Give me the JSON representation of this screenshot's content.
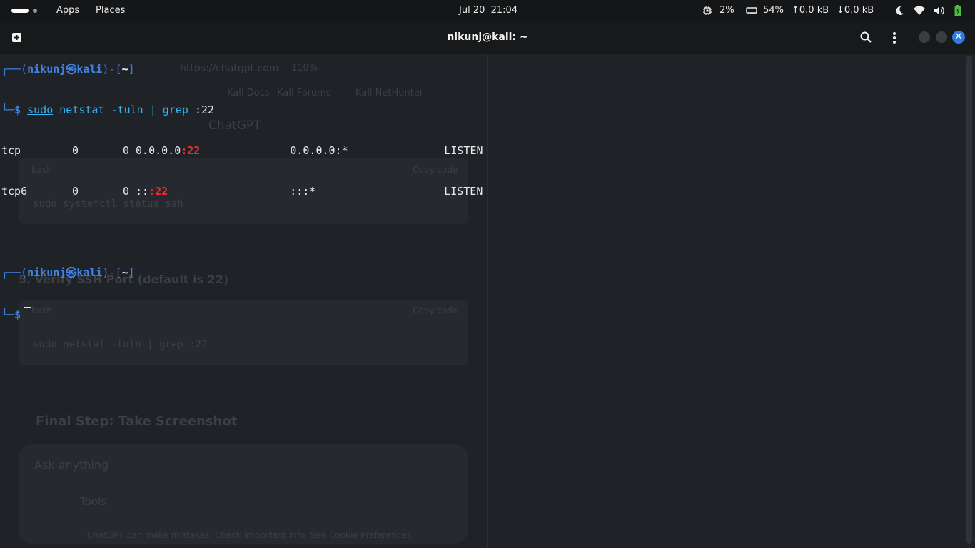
{
  "topbar": {
    "apps_label": "Apps",
    "places_label": "Places",
    "date": "Jul 20",
    "time": "21:04",
    "cpu": "2%",
    "memory": "54%",
    "upload": "0.0 kB",
    "download": "0.0 kB"
  },
  "window": {
    "title": "nikunj@kali: ~"
  },
  "terminal": {
    "prompt_user": "nikunj",
    "prompt_at": "㉿",
    "prompt_host": "kali",
    "prompt_dir": "~",
    "command": {
      "sudo": "sudo",
      "netstat": "netstat",
      "args": "-tuln",
      "pipe": "|",
      "grep": "grep",
      "pattern": ":22"
    },
    "rows": [
      {
        "proto": "tcp",
        "recvq": "0",
        "sendq": "0",
        "local_prefix": "0.0.0.0",
        "local_port": ":22",
        "foreign": "0.0.0.0:*",
        "state": "LISTEN"
      },
      {
        "proto": "tcp6",
        "recvq": "0",
        "sendq": "0",
        "local_prefix": "::",
        "local_port": ":22",
        "foreign": ":::*",
        "state": "LISTEN"
      }
    ]
  },
  "background": {
    "url": "https://chatgpt.com",
    "zoom": "110%",
    "bookmarks": [
      "Kali Docs",
      "Kali Forums",
      "Kali NetHunter"
    ],
    "app_title": "ChatGPT",
    "code_lang_1": "bash",
    "copy_label_1": "Copy code",
    "code_1": "sudo systemctl status ssh",
    "section_heading": "5. Verify SSH Port (default is 22)",
    "code_lang_2": "bash",
    "copy_label_2": "Copy code",
    "code_2": "sudo netstat -tuln | grep :22",
    "final_heading": "Final Step: Take Screenshot",
    "input_placeholder": "Ask anything",
    "tools_label": "Tools",
    "disclaimer": "ChatGPT can make mistakes. Check important info. See",
    "disclaimer_link": "Cookie Preferences."
  }
}
